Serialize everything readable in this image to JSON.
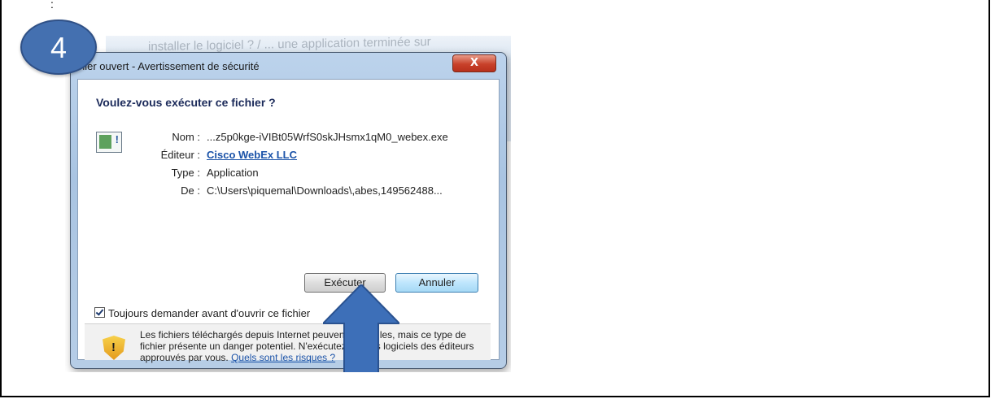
{
  "page": {
    "top_mark": ":",
    "step_number": "4"
  },
  "background_window": {
    "title_text": "installer le logiciel ? / ... une application terminée sur"
  },
  "dialog": {
    "title": "hier ouvert - Avertissement de sécurité",
    "close_label": "X",
    "question": "Voulez-vous exécuter ce fichier ?",
    "fields": [
      {
        "label": "Nom :",
        "value": "...z5p0kge-iVIBt05WrfS0skJHsmx1qM0_webex.exe",
        "is_link": false
      },
      {
        "label": "Éditeur :",
        "value": "Cisco WebEx LLC",
        "is_link": true
      },
      {
        "label": "Type :",
        "value": "Application",
        "is_link": false
      },
      {
        "label": "De :",
        "value": "C:\\Users\\piquemal\\Downloads\\,abes,149562488...",
        "is_link": false
      }
    ],
    "run_button": "Exécuter",
    "cancel_button": "Annuler",
    "checkbox_label": "Toujours demander avant d'ouvrir ce fichier",
    "checkbox_checked": true,
    "warning_text": "Les fichiers téléchargés depuis Internet peuvent être utiles, mais ce type de fichier présente un danger potentiel. N'exécutez que les logiciels des éditeurs approuvés par vous.",
    "warning_link": "Quels sont les risques ?"
  },
  "colors": {
    "badge": "#4470b0",
    "arrow": "#3d6fb8",
    "link": "#1a52a8"
  }
}
